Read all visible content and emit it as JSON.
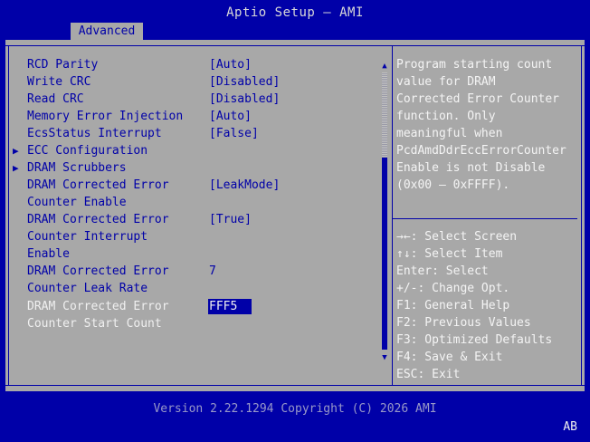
{
  "header": {
    "title": "Aptio Setup – AMI",
    "active_tab": "Advanced"
  },
  "settings": [
    {
      "label": "RCD Parity",
      "value": "[Auto]",
      "submenu": false
    },
    {
      "label": "Write CRC",
      "value": "[Disabled]",
      "submenu": false
    },
    {
      "label": "Read CRC",
      "value": "[Disabled]",
      "submenu": false
    },
    {
      "label": "Memory Error Injection",
      "value": "[Auto]",
      "submenu": false
    },
    {
      "label": "EcsStatus Interrupt",
      "value": "[False]",
      "submenu": false
    },
    {
      "label": "ECC Configuration",
      "value": "",
      "submenu": true
    },
    {
      "label": "DRAM Scrubbers",
      "value": "",
      "submenu": true
    },
    {
      "label_lines": [
        "DRAM Corrected Error",
        "Counter Enable"
      ],
      "value": "[LeakMode]"
    },
    {
      "label_lines": [
        "DRAM Corrected Error",
        "Counter Interrupt",
        "Enable"
      ],
      "value": "[True]"
    },
    {
      "label_lines": [
        "DRAM Corrected Error",
        "Counter Leak Rate"
      ],
      "value": "7"
    },
    {
      "label_lines": [
        "DRAM Corrected Error",
        "Counter Start Count"
      ],
      "value": "FFF5",
      "selected": true
    }
  ],
  "help_text": [
    "Program starting count",
    "value for DRAM",
    "Corrected Error Counter",
    "function. Only",
    "meaningful when",
    "PcdAmdDdrEccErrorCounter",
    "Enable is not Disable",
    "(0x00 – 0xFFFF)."
  ],
  "key_help": [
    {
      "key": "→←",
      "action": ": Select Screen"
    },
    {
      "key": "↑↓",
      "action": ": Select Item"
    },
    {
      "key": "Enter",
      "action": ": Select"
    },
    {
      "key": "+/-",
      "action": ": Change Opt."
    },
    {
      "key": "F1",
      "action": ": General Help"
    },
    {
      "key": "F2",
      "action": ": Previous Values"
    },
    {
      "key": "F3",
      "action": ": Optimized Defaults"
    },
    {
      "key": "F4",
      "action": ": Save & Exit"
    },
    {
      "key": "ESC",
      "action": ": Exit"
    }
  ],
  "footer": {
    "version": "Version 2.22.1294 Copyright (C) 2026 AMI",
    "badge": "AB"
  },
  "colors": {
    "background_blue": "#0000a8",
    "panel_gray": "#a8a8a8",
    "highlight_white": "#f4f4f4"
  }
}
